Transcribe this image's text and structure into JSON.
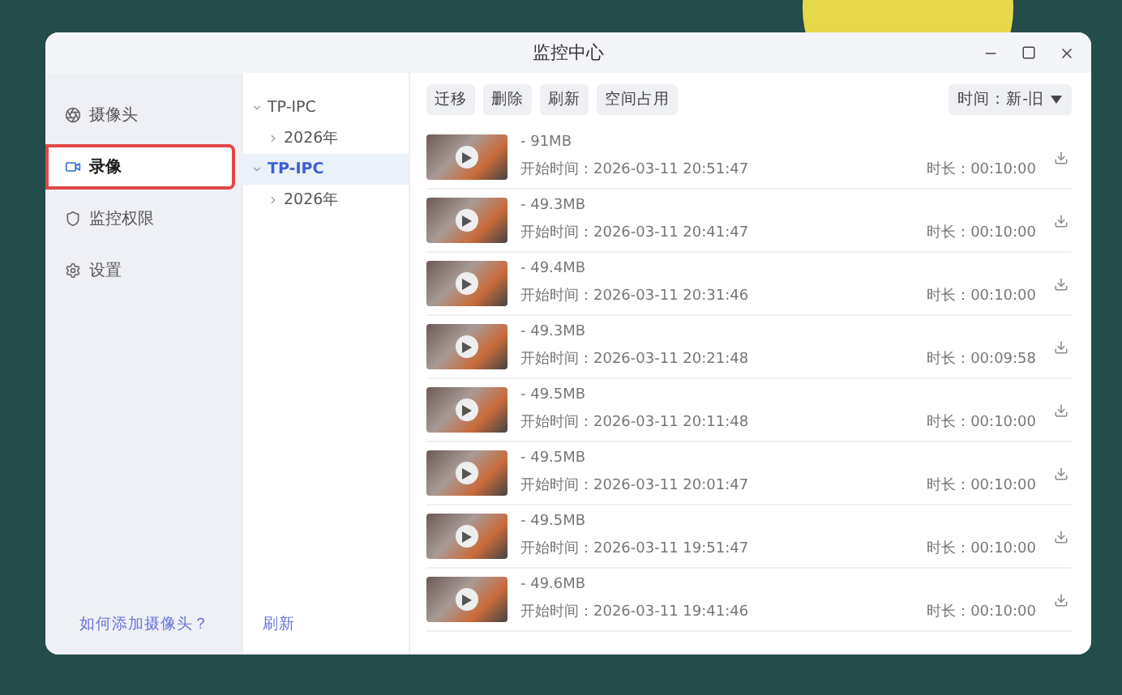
{
  "window": {
    "title": "监控中心"
  },
  "nav": {
    "items": [
      {
        "label": "摄像头",
        "selected": false,
        "highlighted": false
      },
      {
        "label": "录像",
        "selected": true,
        "highlighted": true
      },
      {
        "label": "监控权限",
        "selected": false,
        "highlighted": false
      },
      {
        "label": "设置",
        "selected": false,
        "highlighted": false
      }
    ],
    "help_link": "如何添加摄像头？"
  },
  "tree": {
    "items": [
      {
        "label": "TP-IPC",
        "selected": false,
        "expanded": true,
        "children": [
          {
            "label": "2026年",
            "selected": false,
            "expanded": false
          }
        ]
      },
      {
        "label": "TP-IPC",
        "selected": true,
        "expanded": true,
        "children": [
          {
            "label": "2026年",
            "selected": false,
            "expanded": false
          }
        ]
      }
    ],
    "refresh_link": "刷新"
  },
  "toolbar": {
    "buttons": [
      "迁移",
      "删除",
      "刷新",
      "空间占用"
    ],
    "sort": "时间：新-旧"
  },
  "recordings": [
    {
      "size": "- 91MB",
      "start": "开始时间：2026-03-11 20:51:47",
      "duration": "时长：00:10:00"
    },
    {
      "size": "- 49.3MB",
      "start": "开始时间：2026-03-11 20:41:47",
      "duration": "时长：00:10:00"
    },
    {
      "size": "- 49.4MB",
      "start": "开始时间：2026-03-11 20:31:46",
      "duration": "时长：00:10:00"
    },
    {
      "size": "- 49.3MB",
      "start": "开始时间：2026-03-11 20:21:48",
      "duration": "时长：00:09:58"
    },
    {
      "size": "- 49.5MB",
      "start": "开始时间：2026-03-11 20:11:48",
      "duration": "时长：00:10:00"
    },
    {
      "size": "- 49.5MB",
      "start": "开始时间：2026-03-11 20:01:47",
      "duration": "时长：00:10:00"
    },
    {
      "size": "- 49.5MB",
      "start": "开始时间：2026-03-11 19:51:47",
      "duration": "时长：00:10:00"
    },
    {
      "size": "- 49.6MB",
      "start": "开始时间：2026-03-11 19:41:46",
      "duration": "时长：00:10:00"
    }
  ]
}
